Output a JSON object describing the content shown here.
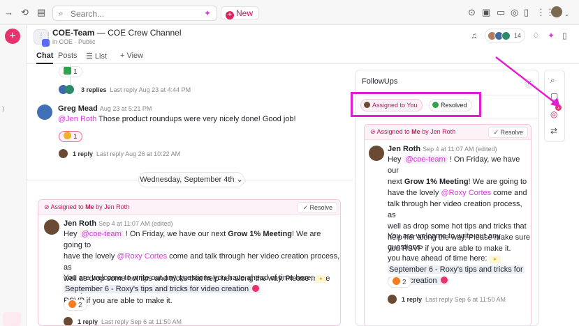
{
  "topbar": {
    "forward_icon": "arrow-right-icon",
    "history_icon": "history-icon",
    "calendar_icon": "calendar-icon",
    "search_placeholder": "Search...",
    "new_label": "New",
    "right_icons": [
      "check-circle-icon",
      "clipboard-icon",
      "video-icon",
      "alarm-icon",
      "document-icon",
      "grid-icon",
      "profile-icon"
    ]
  },
  "channel": {
    "name": "COE-Team",
    "title_suffix": " — COE Crew Channel",
    "subtitle": "in COE · Public",
    "tabs": [
      {
        "label": "Chat"
      },
      {
        "label": "Posts"
      },
      {
        "label": "☰ List"
      },
      {
        "label": "+ View"
      }
    ],
    "member_count": "14"
  },
  "feed": {
    "reaction_top": "1",
    "thread1": {
      "replies": "3 replies",
      "last": "Last reply Aug 23 at 4:44 PM"
    },
    "msg1": {
      "author": "Greg Mead",
      "time": "Aug 23 at 5:21 PM",
      "mention": "@Jen Roth",
      "text": " Those product roundups were very nicely done! Good job!",
      "reaction": "1",
      "reply": "1 reply",
      "last": "Last reply Aug 26 at 10:22 AM"
    },
    "date_divider": "Wednesday, September 4th ⌄"
  },
  "assigned": {
    "prefix": "Assigned to ",
    "me": "Me",
    "by": " by Jen Roth",
    "resolve": "✓ Resolve",
    "author": "Jen Roth",
    "time": "Sep 4 at 11:07 AM (edited)",
    "hey": "Hey ",
    "coe_mention": "@coe-team",
    "line1": " ! On Friday, we have our next ",
    "bold": "Grow 1% Meeting",
    "line1b": "! We are going to",
    "line2a": "have the lovely ",
    "roxy": "@Roxy Cortes",
    "line2b": " come and talk through her video creation process, as",
    "line3": "well as drop some hot tips and tricks that help her along the way. Please make sure you",
    "line4": "RSVP if you are able to make it.",
    "para2": "You are welcome to write out any questions you have ahead of time here:",
    "topic": "September 6 - Roxy's tips and tricks for video creation",
    "reaction": "2",
    "reply": "1 reply",
    "last": "Last reply Sep 6 at 11:50 AM"
  },
  "followups": {
    "title": "FollowUps",
    "chip_you": "Assigned to You",
    "chip_resolved": "Resolved",
    "card": {
      "prefix": "Assigned to ",
      "me": "Me",
      "by": " by Jen Roth",
      "resolve": "✓ Resolve",
      "author": "Jen Roth",
      "time": "Sep 4 at 11:07 AM (edited)",
      "l1a": "Hey ",
      "coe": "@coe-team",
      "l1b": " ! On Friday, we have our",
      "l2a": "next ",
      "bold": "Grow 1% Meeting",
      "l2b": "! We are going to",
      "l3a": "have the lovely ",
      "roxy": "@Roxy Cortes",
      "l3b": " come and",
      "l4": "talk through her video creation process, as",
      "l5": "well as drop some hot tips and tricks that",
      "l6": "help her along the way. Please make sure",
      "l7": "you RSVP if you are able to make it.",
      "p2a": "You are welcome to write out any questions",
      "p2b": "you have ahead of time here:",
      "topic1": "September 6 - Roxy's tips and tricks for",
      "topic2": "video creation",
      "reaction": "2",
      "reply": "1 reply",
      "last": "Last reply Sep 6 at 11:50 AM"
    },
    "badge": "1"
  },
  "colors": {
    "accent": "#e0245e",
    "highlight": "#e020d0",
    "mention": "#d63bd6"
  }
}
